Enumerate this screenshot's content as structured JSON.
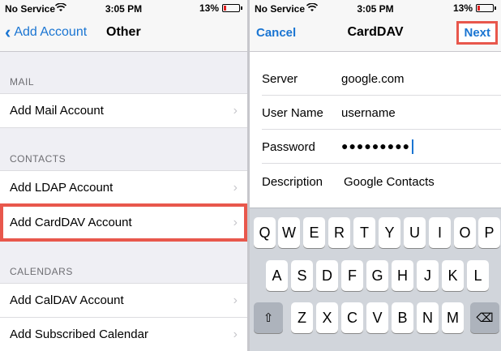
{
  "left": {
    "status": {
      "carrier": "No Service",
      "time": "3:05 PM",
      "battery": "13%"
    },
    "nav": {
      "back_label": "Add Account",
      "title": "Other"
    },
    "sections": [
      {
        "header": "MAIL",
        "items": [
          {
            "label": "Add Mail Account",
            "highlighted": false
          }
        ]
      },
      {
        "header": "CONTACTS",
        "items": [
          {
            "label": "Add LDAP Account",
            "highlighted": false
          },
          {
            "label": "Add CardDAV Account",
            "highlighted": true
          }
        ]
      },
      {
        "header": "CALENDARS",
        "items": [
          {
            "label": "Add CalDAV Account",
            "highlighted": false
          },
          {
            "label": "Add Subscribed Calendar",
            "highlighted": false
          }
        ]
      }
    ]
  },
  "right": {
    "status": {
      "carrier": "No Service",
      "time": "3:05 PM",
      "battery": "13%"
    },
    "nav": {
      "cancel_label": "Cancel",
      "title": "CardDAV",
      "next_label": "Next"
    },
    "form": {
      "server": {
        "label": "Server",
        "value": "google.com"
      },
      "username": {
        "label": "User Name",
        "value": "username"
      },
      "password": {
        "label": "Password",
        "value": "●●●●●●●●●"
      },
      "description": {
        "label": "Description",
        "value": "Google Contacts"
      }
    },
    "keyboard": {
      "row1": [
        "Q",
        "W",
        "E",
        "R",
        "T",
        "Y",
        "U",
        "I",
        "O",
        "P"
      ],
      "row2": [
        "A",
        "S",
        "D",
        "F",
        "G",
        "H",
        "J",
        "K",
        "L"
      ],
      "row3": [
        "Z",
        "X",
        "C",
        "V",
        "B",
        "N",
        "M"
      ],
      "shift": "⇧",
      "backspace": "⌫"
    }
  },
  "colors": {
    "accent": "#1a75d2",
    "highlight": "#e8574c",
    "battery_low": "#e02020"
  }
}
